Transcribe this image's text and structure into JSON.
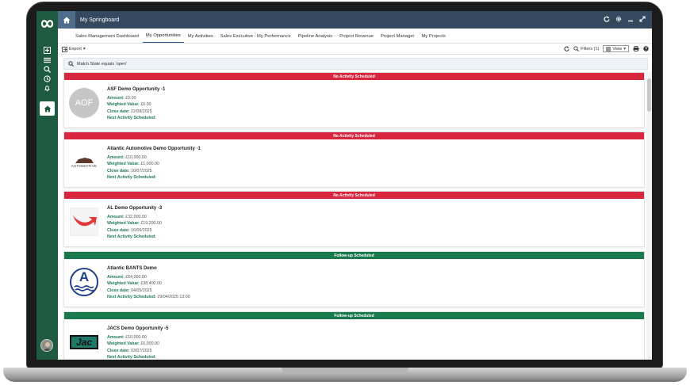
{
  "app": {
    "title": "My Springboard"
  },
  "colors": {
    "rail": "#1d5a3f",
    "topbar": "#34495e",
    "red_band": "#d7263d",
    "green_band": "#1b7a4c",
    "label_green": "#1f7a52"
  },
  "tabs": [
    {
      "label": "Sales Management Dashboard"
    },
    {
      "label": "My Opportunities"
    },
    {
      "label": "My Activities"
    },
    {
      "label": "Sales Executive - My Performance"
    },
    {
      "label": "Pipeline Analysis"
    },
    {
      "label": "Project Revenue"
    },
    {
      "label": "Project Manager"
    },
    {
      "label": "My Projects"
    }
  ],
  "toolbar": {
    "export_label": "Export",
    "filters_label": "Filters (1)",
    "view_label": "View"
  },
  "filter": {
    "text": "Match State equals 'open'"
  },
  "fields": {
    "amount": "Amount:",
    "weighted": "Weighted Value:",
    "close": "Close date:",
    "next": "Next Activity Scheduled:"
  },
  "opportunities": [
    {
      "band": "No Activity Scheduled",
      "status": "red",
      "name": "ASF Demo Opportunity -1",
      "thumb_text": "AOF",
      "amount": "£0.00",
      "weighted": "£0.00",
      "close": "22/08/2025",
      "next": ""
    },
    {
      "band": "No Activity Scheduled",
      "status": "red",
      "name": "Atlantic Automotive Demo Opportunity -1",
      "thumb_text": "AUTOMOTIVE",
      "amount": "£10,000.00",
      "weighted": "£1,000.00",
      "close": "16/07/2025",
      "next": ""
    },
    {
      "band": "No Activity Scheduled",
      "status": "red",
      "name": "AL Demo Opportunity -3",
      "thumb_text": "",
      "amount": "£32,000.00",
      "weighted": "£19,200.00",
      "close": "16/06/2025",
      "next": ""
    },
    {
      "band": "Follow-up Scheduled",
      "status": "green",
      "name": "Atlantic BANTS Demo",
      "thumb_text": "A",
      "amount": "£64,000.00",
      "weighted": "£38,400.00",
      "close": "04/05/2025",
      "next": "29/04/2025 13:00"
    },
    {
      "band": "Follow-up Scheduled",
      "status": "green",
      "name": "JACS Demo Opportunity -5",
      "thumb_text": "Jac",
      "amount": "£10,000.00",
      "weighted": "£6,000.00",
      "close": "03/07/2025",
      "next": ""
    }
  ]
}
